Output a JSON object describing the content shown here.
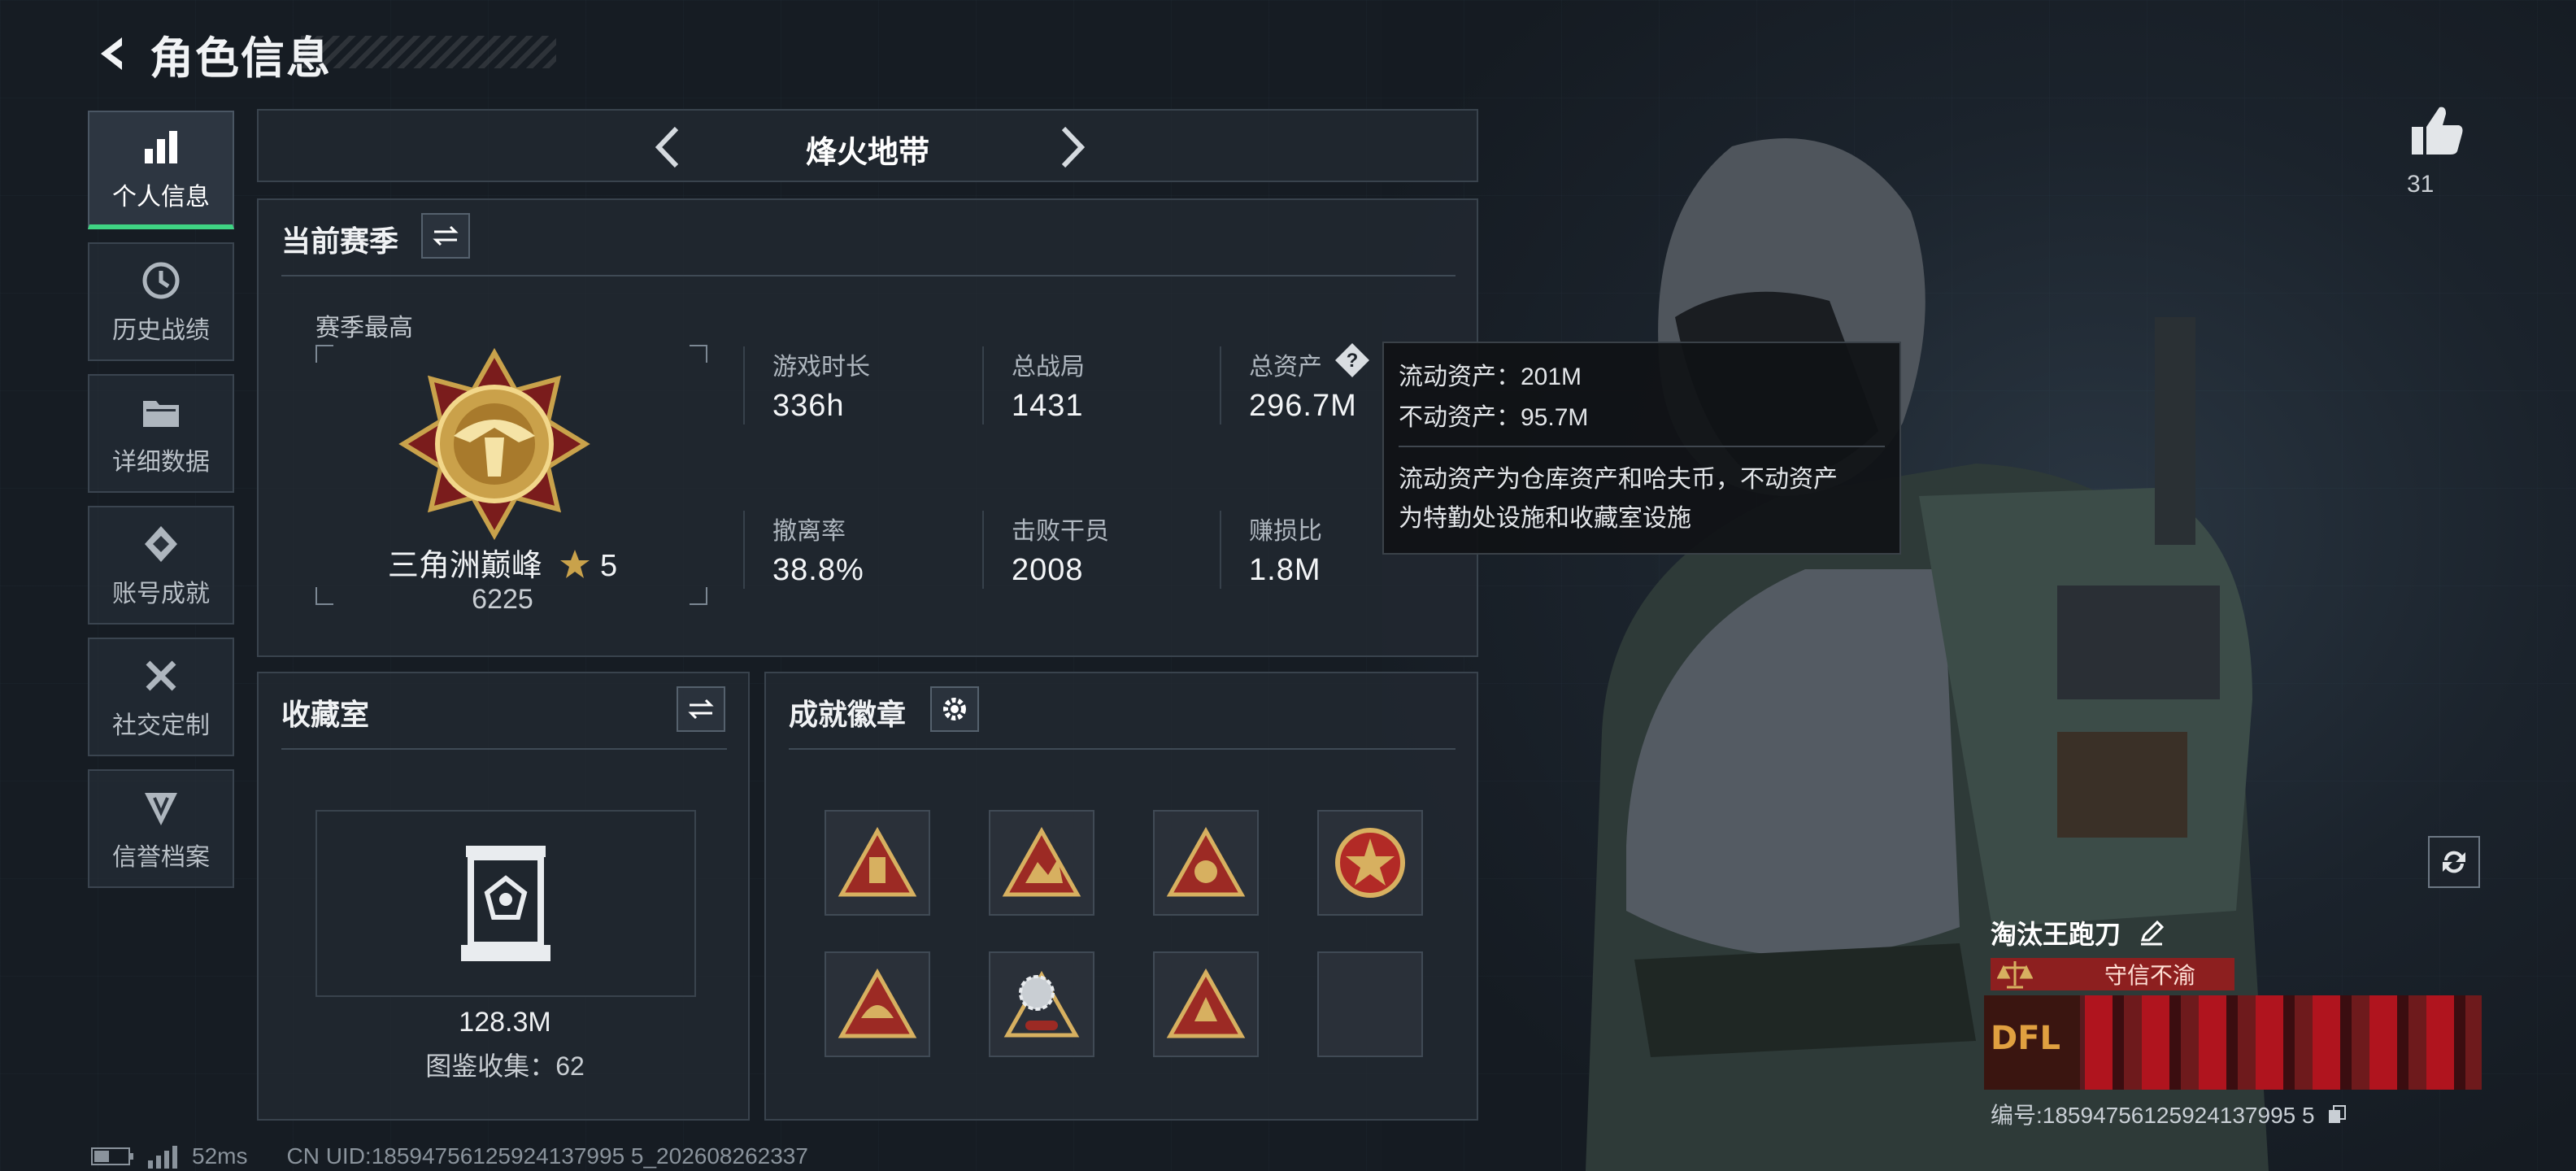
{
  "header": {
    "title": "角色信息"
  },
  "sidebar": {
    "items": [
      {
        "label": "个人信息",
        "icon": "bar-chart-icon",
        "active": true
      },
      {
        "label": "历史战绩",
        "icon": "history-clock-icon",
        "active": false
      },
      {
        "label": "详细数据",
        "icon": "folder-icon",
        "active": false
      },
      {
        "label": "账号成就",
        "icon": "achievement-diamond-icon",
        "active": false
      },
      {
        "label": "社交定制",
        "icon": "wrench-tools-icon",
        "active": false
      },
      {
        "label": "信誉档案",
        "icon": "shield-credit-icon",
        "active": false
      }
    ]
  },
  "mode_selector": {
    "label": "烽火地带"
  },
  "season": {
    "title": "当前赛季",
    "best_label": "赛季最高",
    "rank_name": "三角洲巅峰",
    "rank_stars": "5",
    "rank_points": "6225",
    "stats": [
      {
        "label": "游戏时长",
        "value": "336h"
      },
      {
        "label": "总战局",
        "value": "1431"
      },
      {
        "label": "总资产",
        "value": "296.7M"
      },
      {
        "label": "撤离率",
        "value": "38.8%"
      },
      {
        "label": "击败干员",
        "value": "2008"
      },
      {
        "label": "赚损比",
        "value": "1.8M"
      }
    ]
  },
  "tooltip": {
    "liquid": "流动资产：201M",
    "fixed": "不动资产：95.7M",
    "desc_line1": "流动资产为仓库资产和哈夫币，不动资产",
    "desc_line2": "为特勤处设施和收藏室设施"
  },
  "collection": {
    "title": "收藏室",
    "value": "128.3M",
    "catalog": "图鉴收集：62"
  },
  "achievements": {
    "title": "成就徽章",
    "badge_count": 7,
    "slots": 8
  },
  "profile": {
    "likes": "31",
    "nickname": "淘汰王跑刀",
    "motto": "守信不渝",
    "banner_text": "DFL",
    "uid_label": "编号:18594756125924137995 5"
  },
  "footer": {
    "ping": "52ms",
    "uid": "CN UID:18594756125924137995 5_202608262337"
  },
  "colors": {
    "accent_green": "#3fd483",
    "panel_border": "#39434d",
    "gold": "#c9a24b",
    "red": "#8d1f1f"
  }
}
